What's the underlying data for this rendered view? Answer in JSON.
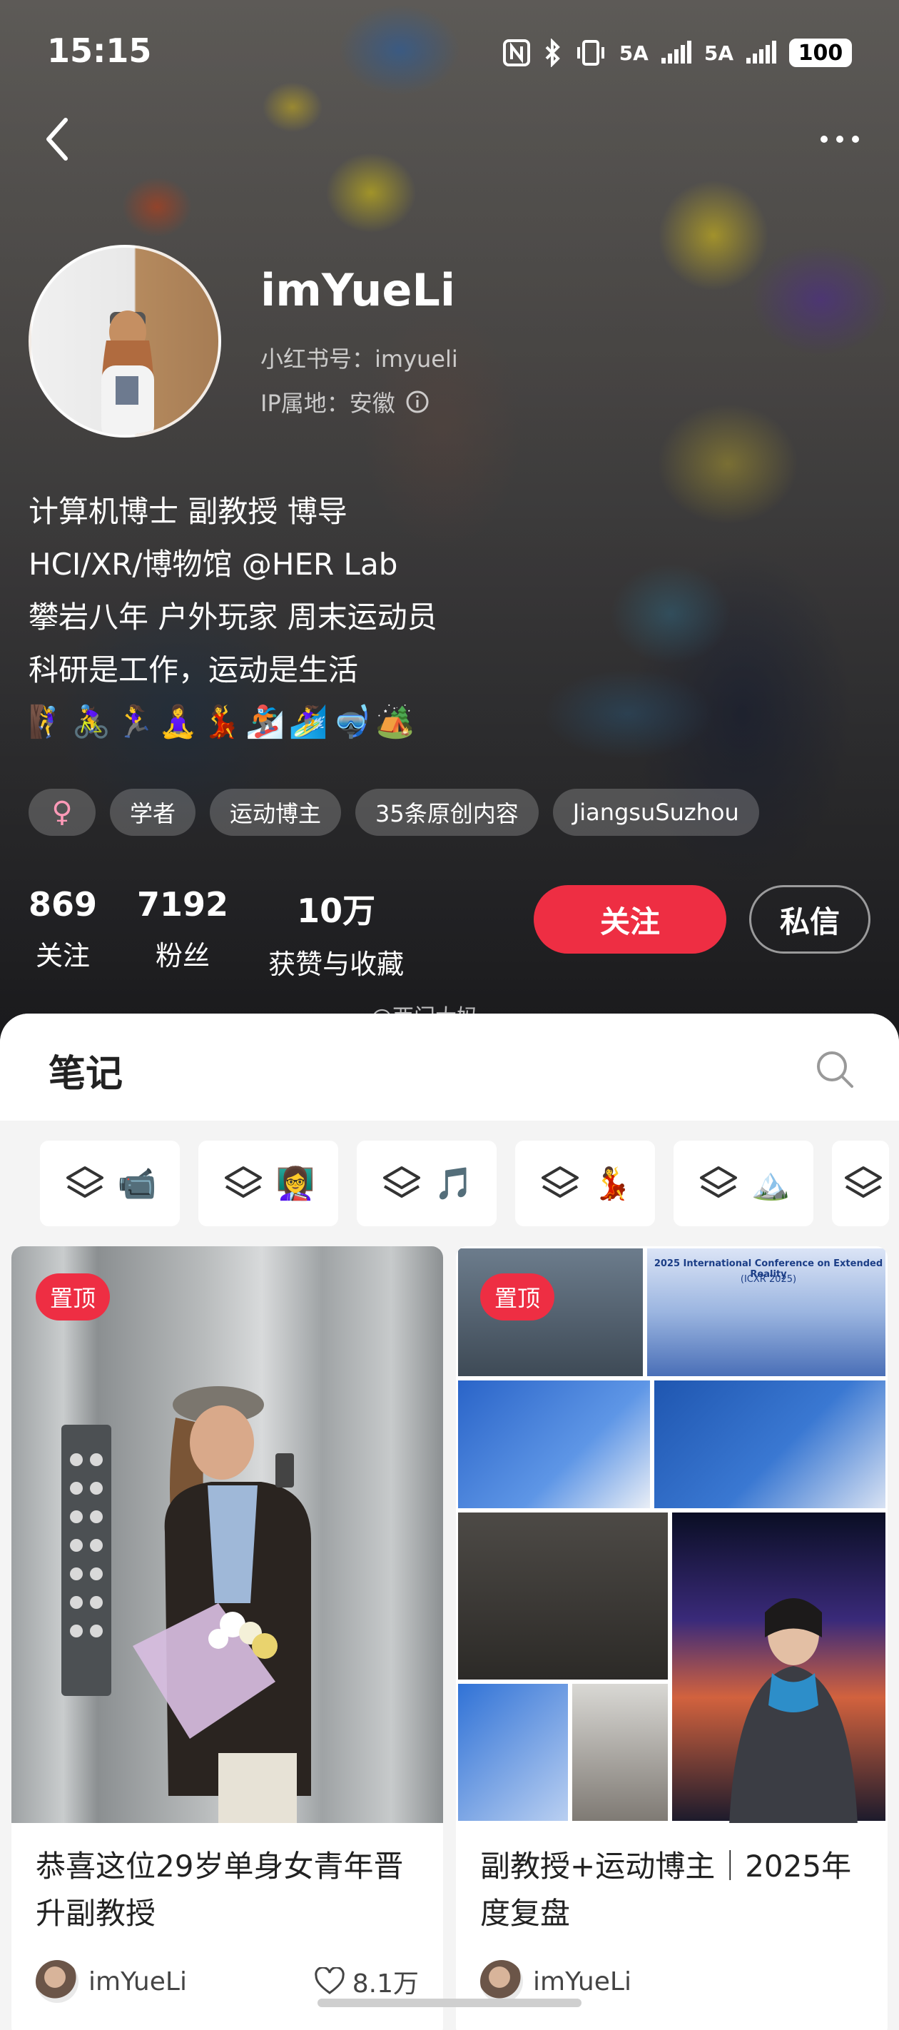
{
  "status_bar": {
    "time": "15:15",
    "network_1": "5A",
    "network_2": "5A",
    "battery": "100"
  },
  "profile": {
    "name": "imYueLi",
    "red_id": "小红书号：imyueli",
    "ip_location": "IP属地：安徽",
    "bio": [
      "计算机博士 副教授 博导",
      "HCI/XR/博物馆 @HER Lab",
      "攀岩八年 户外玩家 周末运动员",
      "科研是工作，运动是生活"
    ],
    "emoji_line": [
      "🧗‍♀️",
      "🚴‍♀️",
      "🏃‍♀️",
      "🧘‍♀️",
      "💃",
      "🏂",
      "🏄‍♀️",
      "🤿",
      "🏕️"
    ],
    "tags": {
      "gender": "♀",
      "items": [
        "学者",
        "运动博主",
        "35条原创内容",
        "JiangsuSuzhou"
      ]
    },
    "stats": [
      {
        "value": "869",
        "label": "关注"
      },
      {
        "value": "7192",
        "label": "粉丝"
      },
      {
        "value": "10万",
        "label": "获赞与收藏"
      }
    ],
    "follow_label": "关注",
    "message_label": "私信"
  },
  "watermark": "@西门大妈",
  "notes": {
    "title": "笔记",
    "collections": [
      {
        "emoji": "📹"
      },
      {
        "emoji": "👩‍🏫"
      },
      {
        "emoji": "🎵"
      },
      {
        "emoji": "💃"
      },
      {
        "emoji": "🏔️"
      }
    ],
    "cards": [
      {
        "pin": "置顶",
        "title": "恭喜这位29岁单身女青年晋升副教授",
        "author": "imYueLi",
        "likes": "8.1万"
      },
      {
        "pin": "置顶",
        "title": "副教授+运动博主｜2025年度复盘",
        "author": "imYueLi",
        "collage_text_top": "2025 International Conference on Extended Reality",
        "collage_text_sub": "(ICXR 2025)"
      }
    ]
  },
  "colors": {
    "accent_red": "#ee2e43",
    "gender_pink": "#ff9ab8"
  },
  "icons": [
    "back-icon",
    "more-icon",
    "info-icon",
    "search-icon",
    "stack-icon",
    "heart-icon"
  ]
}
